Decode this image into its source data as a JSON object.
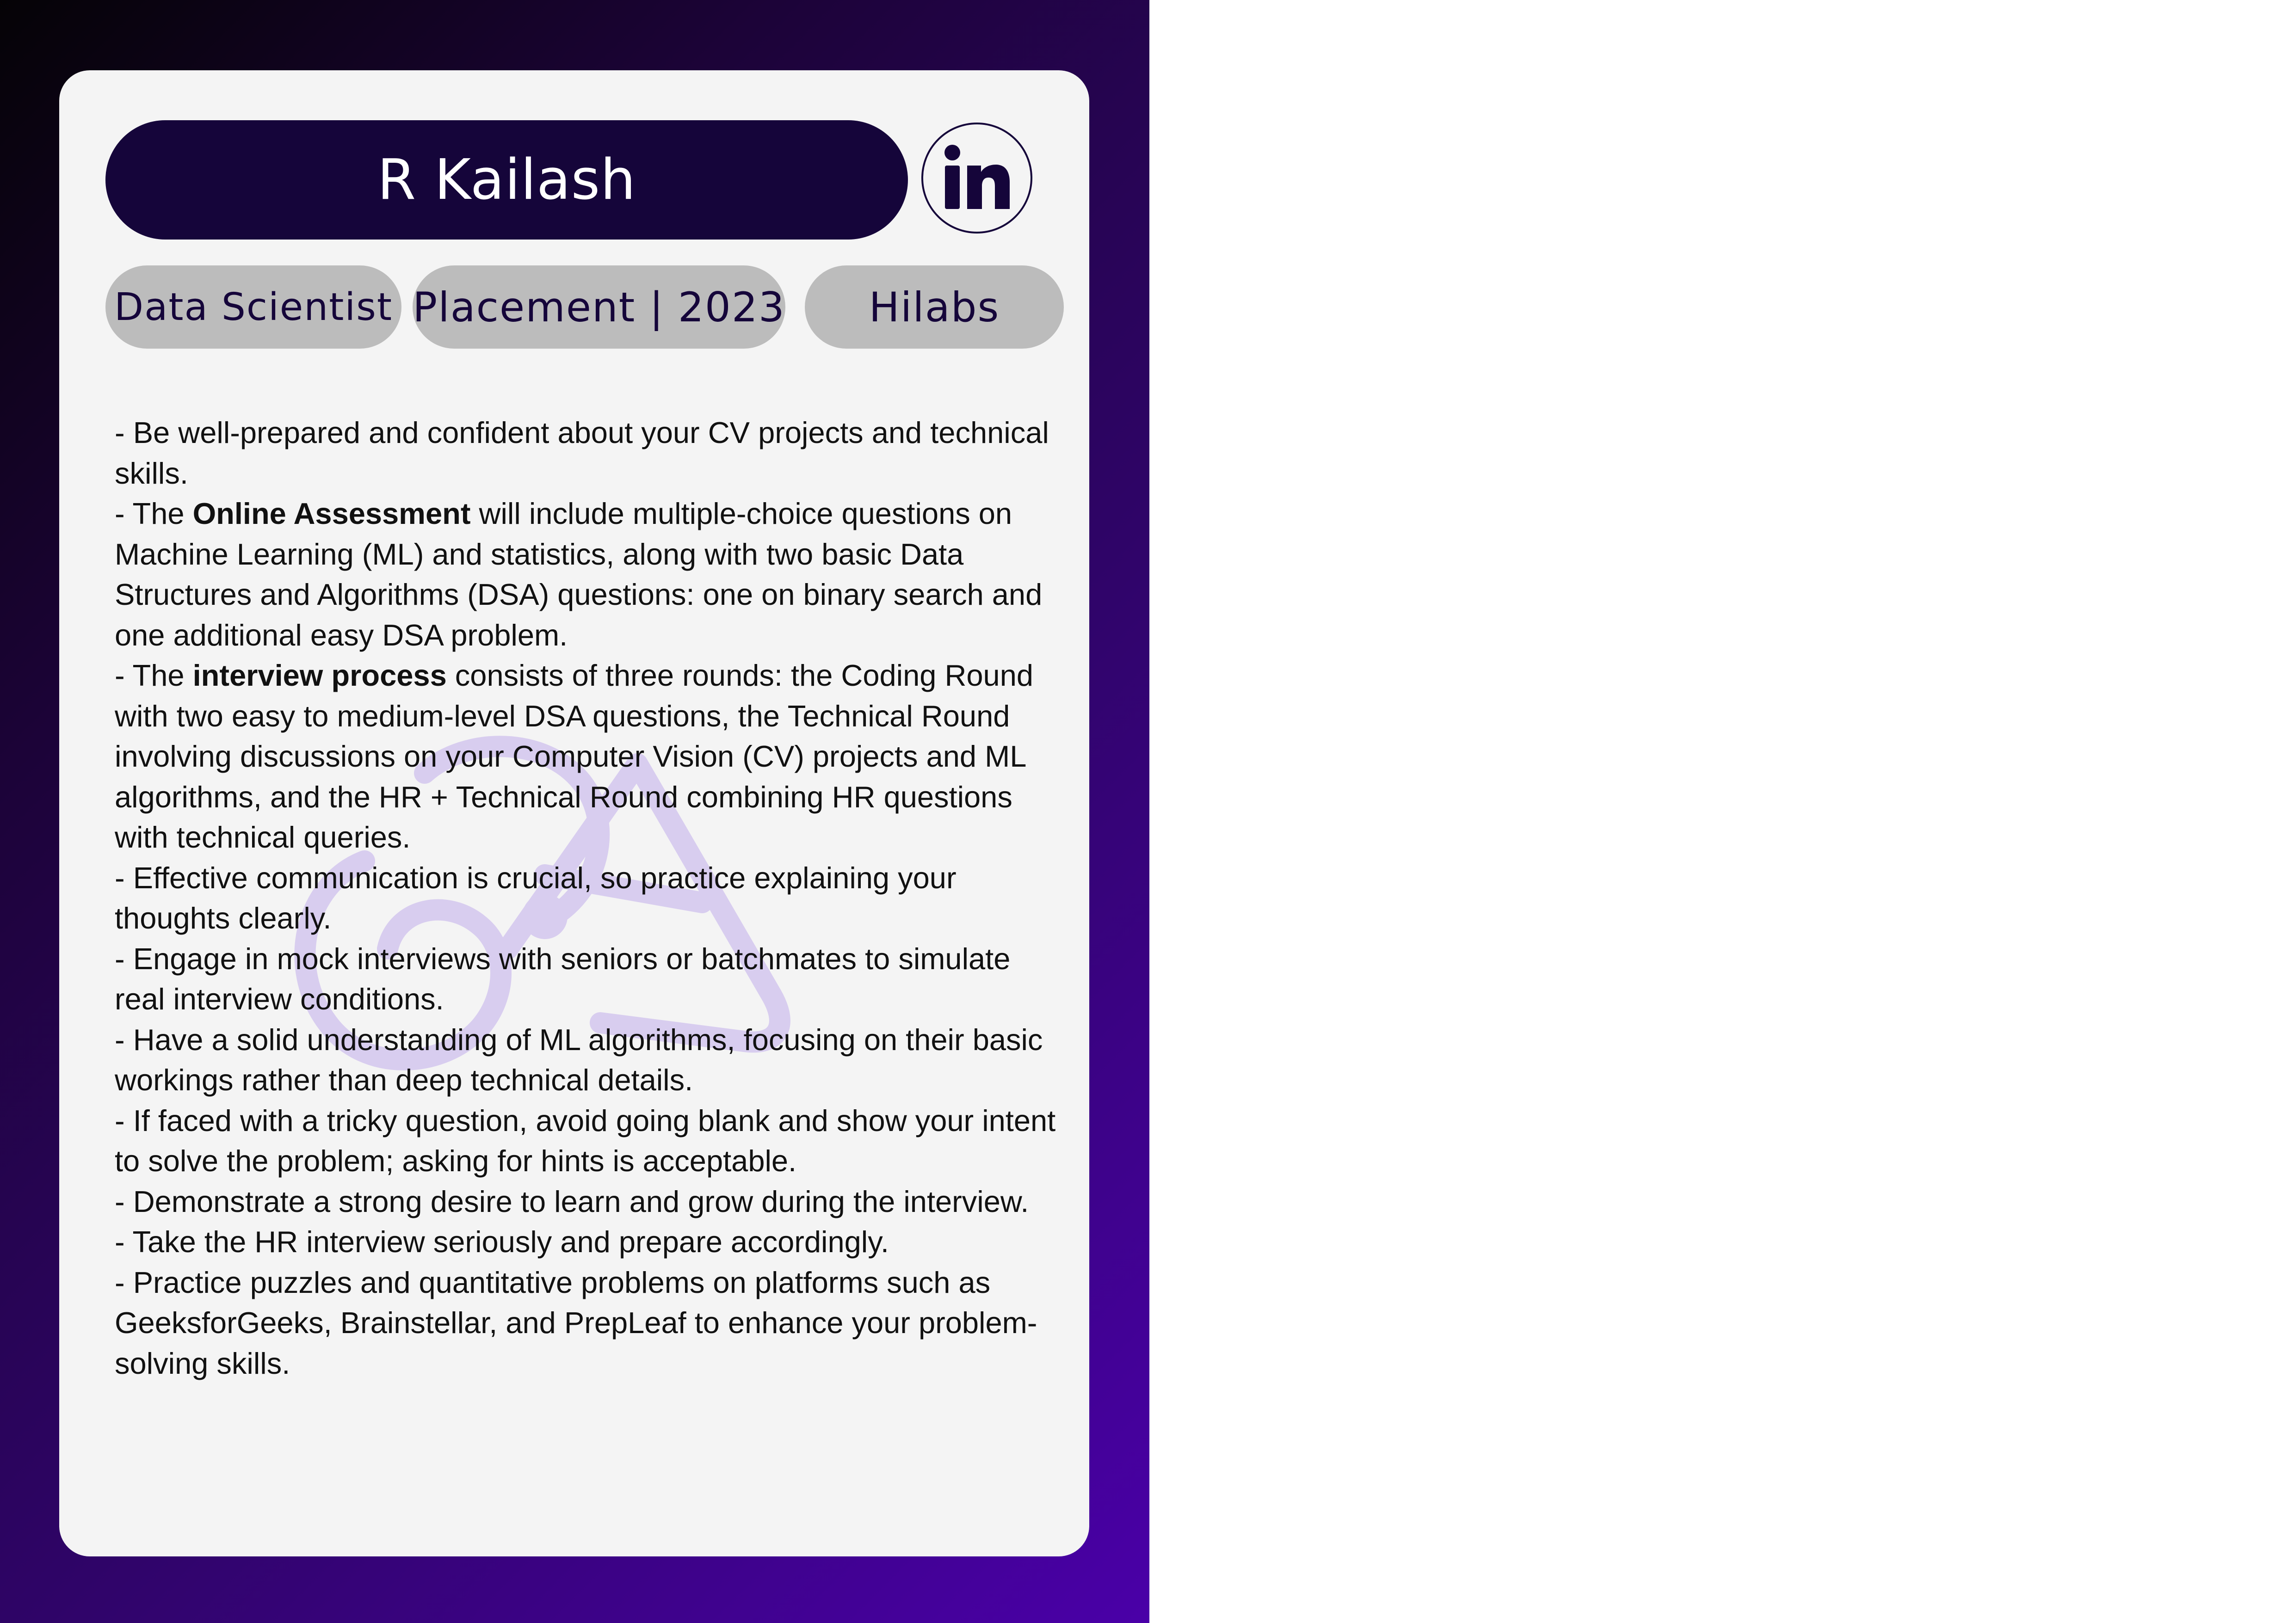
{
  "profile": {
    "name": "R Kailash",
    "linkedin_icon": "linkedin-icon"
  },
  "tags": {
    "role": "Data Scientist",
    "type": "Placement | 2023",
    "company": "Hilabs"
  },
  "tips": [
    {
      "text": "- Be well-prepared and confident about your CV projects and technical skills."
    },
    {
      "pre": "- The ",
      "bold": "Online Assessment",
      "post": " will include multiple-choice questions on Machine Learning (ML) and statistics, along with two basic Data Structures and Algorithms (DSA) questions: one on binary search and one additional easy DSA problem."
    },
    {
      "pre": "- The ",
      "bold": "interview process",
      "post": " consists of three rounds: the Coding Round with two easy to medium-level DSA questions, the Technical Round involving discussions on your Computer Vision (CV) projects and ML algorithms, and the HR + Technical Round combining HR questions with technical queries."
    },
    {
      "text": "- Effective communication is crucial, so practice explaining your thoughts clearly."
    },
    {
      "text": "- Engage in mock interviews with seniors or batchmates to simulate real interview conditions."
    },
    {
      "text": "- Have a solid understanding of ML algorithms, focusing on their basic workings rather than deep technical details."
    },
    {
      "text": "- If faced with a tricky question, avoid going blank and show your intent to solve the problem; asking for hints is acceptable."
    },
    {
      "text": "- Demonstrate a strong desire to learn and grow during the interview."
    },
    {
      "text": "- Take the HR interview seriously and prepare accordingly."
    },
    {
      "text": "- Practice puzzles and quantitative problems on platforms such as GeeksforGeeks, Brainstellar, and PrepLeaf to enhance your problem-solving skills."
    }
  ],
  "colors": {
    "accent": "#15053a",
    "tag_bg": "#bcbcbc",
    "card_bg": "#f4f4f4",
    "gradient_end": "#4a00a8",
    "watermark": "#d8cdef"
  }
}
